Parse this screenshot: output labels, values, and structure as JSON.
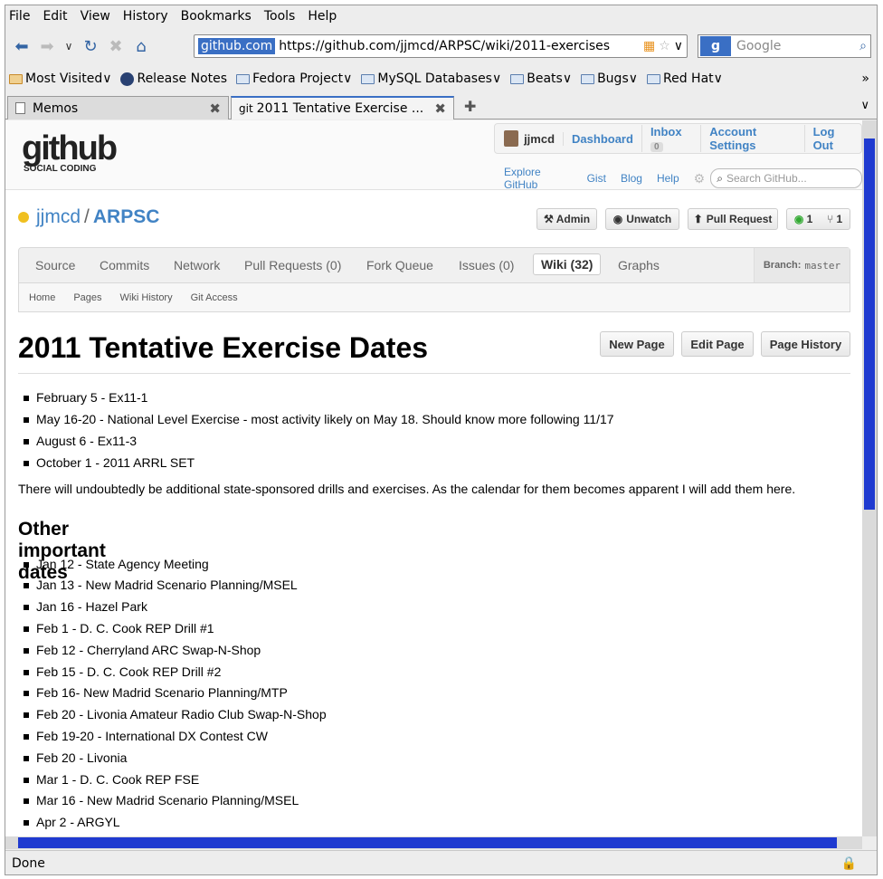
{
  "menu": [
    "File",
    "Edit",
    "View",
    "History",
    "Bookmarks",
    "Tools",
    "Help"
  ],
  "url": {
    "tag": "github.com",
    "address": "https://github.com/jjmcd/ARPSC/wiki/2011-exercises"
  },
  "search_placeholder": "Google",
  "bookmarks": [
    "Most Visited",
    "Release Notes",
    "Fedora Project",
    "MySQL Databases",
    "Beats",
    "Bugs",
    "Red Hat"
  ],
  "tabs": [
    "Memos",
    "2011 Tentative Exercise ..."
  ],
  "status": "Done",
  "gh": {
    "logo_big": "github",
    "logo_small": "SOCIAL CODING",
    "user": "jjmcd",
    "user_links": [
      "Dashboard",
      "Inbox",
      "Account Settings",
      "Log Out"
    ],
    "inbox_count": "0",
    "subnav": [
      "Explore GitHub",
      "Gist",
      "Blog",
      "Help"
    ],
    "search_placeholder": "Search GitHub...",
    "owner": "jjmcd",
    "repo": "ARPSC",
    "actions": [
      "Admin",
      "Unwatch",
      "Pull Request"
    ],
    "watchers": "1",
    "forks": "1",
    "repo_tabs": [
      "Source",
      "Commits",
      "Network",
      "Pull Requests (0)",
      "Fork Queue",
      "Issues (0)",
      "Wiki (32)",
      "Graphs"
    ],
    "branch_label": "Branch:",
    "branch": "master",
    "wiki_nav": [
      "Home",
      "Pages",
      "Wiki History",
      "Git Access"
    ],
    "page_buttons": [
      "New Page",
      "Edit Page",
      "Page History"
    ]
  },
  "page": {
    "title": "2011 Tentative Exercise Dates",
    "exercises": [
      "February 5 - Ex11-1",
      "May 16-20 - National Level Exercise - most activity likely on May 18. Should know more following 11/17",
      "August 6 - Ex11-3",
      "October 1 - 2011 ARRL SET"
    ],
    "note": "There will undoubtedly be additional state-sponsored drills and exercises. As the calendar for them becomes apparent I will add them here.",
    "section2": "Other important dates",
    "dates": [
      "Jan 12 - State Agency Meeting",
      "Jan 13 - New Madrid Scenario Planning/MSEL",
      "Jan 16 - Hazel Park",
      "Feb 1 - D. C. Cook REP Drill #1",
      "Feb 12 - Cherryland ARC Swap-N-Shop",
      "Feb 15 - D. C. Cook REP Drill #2",
      "Feb 16- New Madrid Scenario Planning/MTP",
      "Feb 20 - Livonia Amateur Radio Club Swap-N-Shop",
      "Feb 19-20 - International DX Contest CW",
      "Feb 20 - Livonia",
      "Mar 1 - D. C. Cook REP FSE",
      "Mar 16 - New Madrid Scenario Planning/MSEL",
      "Apr 2 - ARGYL"
    ]
  }
}
